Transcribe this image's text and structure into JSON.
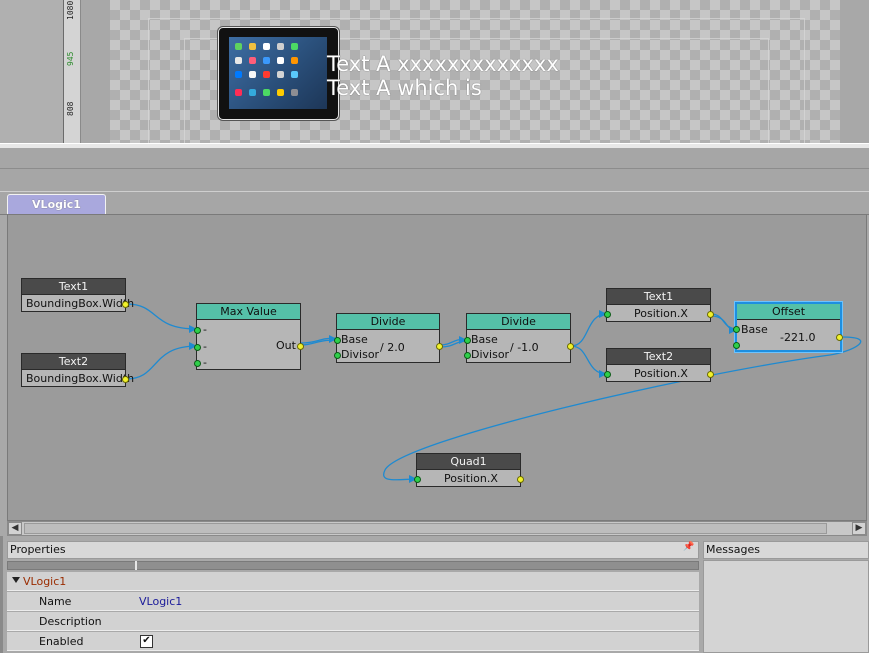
{
  "ruler": {
    "ticks": [
      "1080",
      "945",
      "808"
    ]
  },
  "stage": {
    "caption_line1": "Text A xxxxxxxxxxxxx",
    "caption_line2": "Text A which is"
  },
  "tab": {
    "label": "VLogic1"
  },
  "nodes": {
    "text1_bb": {
      "title": "Text1",
      "port": "BoundingBox.Width"
    },
    "text2_bb": {
      "title": "Text2",
      "port": "BoundingBox.Width"
    },
    "max_value": {
      "title": "Max Value",
      "in1": "-",
      "in2": "-",
      "in3": "-",
      "out": "Out"
    },
    "divide1": {
      "title": "Divide",
      "base": "Base",
      "divisor": "Divisor",
      "value": "/ 2.0"
    },
    "divide2": {
      "title": "Divide",
      "base": "Base",
      "divisor": "Divisor",
      "value": "/ -1.0"
    },
    "text1_pos": {
      "title": "Text1",
      "port": "Position.X"
    },
    "text2_pos": {
      "title": "Text2",
      "port": "Position.X"
    },
    "offset": {
      "title": "Offset",
      "base": "Base",
      "value": "-221.0"
    },
    "quad1": {
      "title": "Quad1",
      "port": "Position.X"
    }
  },
  "scrollbar": {
    "left_arrow": "◀",
    "right_arrow": "▶"
  },
  "properties": {
    "title": "Properties",
    "pin": "📌",
    "group": "VLogic1",
    "rows": [
      {
        "label": "Name",
        "value": "VLogic1"
      },
      {
        "label": "Description",
        "value": ""
      },
      {
        "label": "Enabled",
        "value": "✔"
      }
    ]
  },
  "messages": {
    "title": "Messages"
  },
  "colors": {
    "header_dark": "#4a4a4a",
    "header_teal": "#55c0a8",
    "wire": "#1f8ad0",
    "selected": "#1e8fe0",
    "tab": "#a9a8dd"
  }
}
